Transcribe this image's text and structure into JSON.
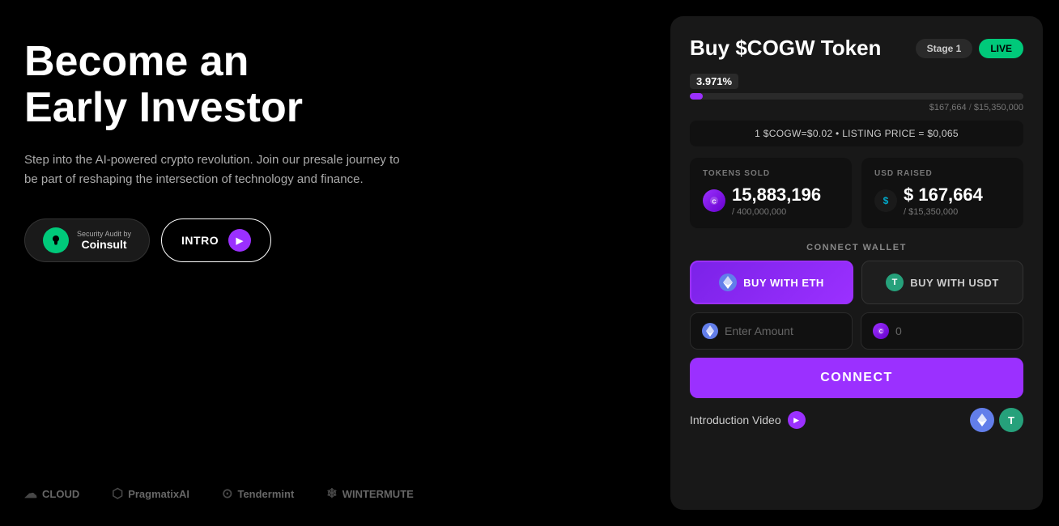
{
  "hero": {
    "title_line1": "Become an",
    "title_line2": "Early Investor",
    "subtitle": "Step into the AI-powered crypto revolution. Join our presale journey to be part of reshaping the intersection of technology and finance.",
    "btn_audit": "Security Audit by\nCoinsult",
    "btn_intro": "INTRO"
  },
  "partners": [
    {
      "name": "CLOUD",
      "icon": "☁"
    },
    {
      "name": "PragmatixAI",
      "icon": "⬡"
    },
    {
      "name": "Tendermint",
      "icon": "⊙"
    },
    {
      "name": "WINTERMUTE",
      "icon": "❄"
    }
  ],
  "buy_card": {
    "title": "Buy $COGW Token",
    "badge_stage": "Stage 1",
    "badge_live": "LIVE",
    "progress_percent": "3.971%",
    "progress_fill_width": "3.971",
    "progress_raised": "$167,664",
    "progress_goal": "$15,350,000",
    "price_info": "1 $COGW=$0.02  •  LISTING PRICE = $0,065",
    "tokens_sold_label": "TOKENS SOLD",
    "tokens_sold_value": "15,883,196",
    "tokens_sold_max": "/ 400,000,000",
    "usd_raised_label": "USD RAISED",
    "usd_raised_value": "$ 167,664",
    "usd_raised_max": "/ $15,350,000",
    "connect_wallet_label": "CONNECT WALLET",
    "buy_eth_label": "BUY WITH ETH",
    "buy_usdt_label": "BUY WITH USDT",
    "enter_amount_placeholder": "Enter Amount",
    "tokens_placeholder": "0",
    "connect_button": "CONNECT",
    "intro_video_label": "Introduction Video"
  }
}
